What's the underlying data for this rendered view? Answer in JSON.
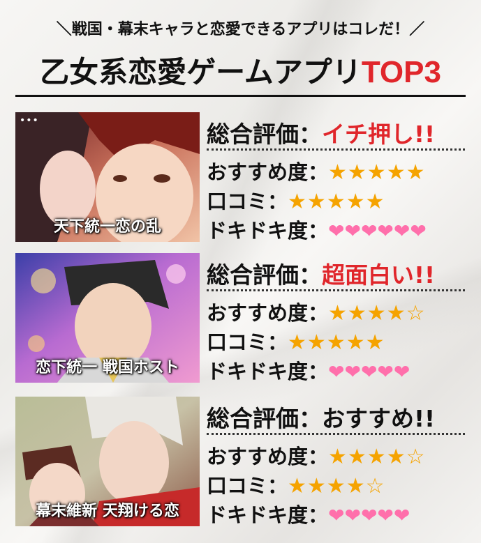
{
  "header": {
    "subtitle": "＼戦国・幕末キャラと恋愛できるアプリはコレだ！／",
    "title_main": "乙女系恋愛ゲームアプリ",
    "title_accent": "TOP3"
  },
  "colors": {
    "accent_red": "#e0262b",
    "star": "#f5a300",
    "heart": "#ff6fab"
  },
  "apps": [
    {
      "caption": "天下統一恋の乱",
      "overall_label": "総合評価：",
      "overall_value": "イチ押し!!",
      "overall_color": "#e0262b",
      "recommend_label": "おすすめ度：",
      "recommend_stars": "★★★★★",
      "recommend_rating": 5,
      "review_label": "口コミ：",
      "review_stars": "★★★★★",
      "review_rating": 5,
      "doki_label": "ドキドキ度：",
      "doki_hearts": "❤❤❤❤❤❤",
      "doki_rating": 6
    },
    {
      "caption": "恋下統一 戦国ホスト",
      "overall_label": "総合評価：",
      "overall_value": "超面白い!!",
      "overall_color": "#e0262b",
      "recommend_label": "おすすめ度：",
      "recommend_stars": "★★★★☆",
      "recommend_rating": 4,
      "review_label": "口コミ：",
      "review_stars": "★★★★★",
      "review_rating": 5,
      "doki_label": "ドキドキ度：",
      "doki_hearts": "❤❤❤❤❤",
      "doki_rating": 5
    },
    {
      "caption": "幕末維新 天翔ける恋",
      "overall_label": "総合評価：",
      "overall_value": "おすすめ!!",
      "overall_color": "#111111",
      "recommend_label": "おすすめ度：",
      "recommend_stars": "★★★★☆",
      "recommend_rating": 4,
      "review_label": "口コミ：",
      "review_stars": "★★★★☆",
      "review_rating": 4,
      "doki_label": "ドキドキ度：",
      "doki_hearts": "❤❤❤❤❤",
      "doki_rating": 5
    }
  ]
}
